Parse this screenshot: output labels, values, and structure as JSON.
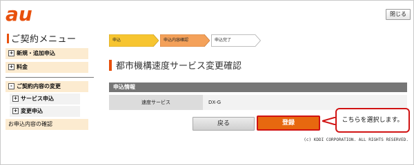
{
  "brand": {
    "logo_text": "au",
    "logo_color": "#e8500c"
  },
  "header": {
    "close_label": "閉じる"
  },
  "sidebar": {
    "title": "ご契約メニュー",
    "items": [
      {
        "label": "新規・追加申込",
        "marker": "+"
      },
      {
        "label": "料金",
        "marker": "+"
      },
      {
        "label": "ご契約内容の変更",
        "marker": "-"
      }
    ],
    "sub_items": [
      {
        "label": "サービス申込",
        "marker": "+"
      },
      {
        "label": "変更申込",
        "marker": "+"
      }
    ],
    "plain_item": "お申込内容の確認"
  },
  "steps": [
    {
      "label": "申込",
      "state": "done",
      "color": "#f7c530"
    },
    {
      "label": "申込内容確認",
      "state": "current",
      "color": "#f4a15a"
    },
    {
      "label": "申込完了",
      "state": "pending",
      "color": "#ffffff"
    }
  ],
  "page": {
    "title": "都市機構速度サービス変更確認"
  },
  "info": {
    "header": "申込情報",
    "rows": [
      {
        "label": "速度サービス",
        "value": "DX-G"
      }
    ]
  },
  "actions": {
    "back_label": "戻る",
    "register_label": "登録"
  },
  "callout": {
    "text": "こちらを選択します。"
  },
  "footer": {
    "copyright": "(c) KDDI CORPORATION. ALL RIGHTS RESERVED."
  },
  "colors": {
    "accent": "#e8500c",
    "highlight": "#d01212",
    "menu_bg": "#fcebd0"
  }
}
